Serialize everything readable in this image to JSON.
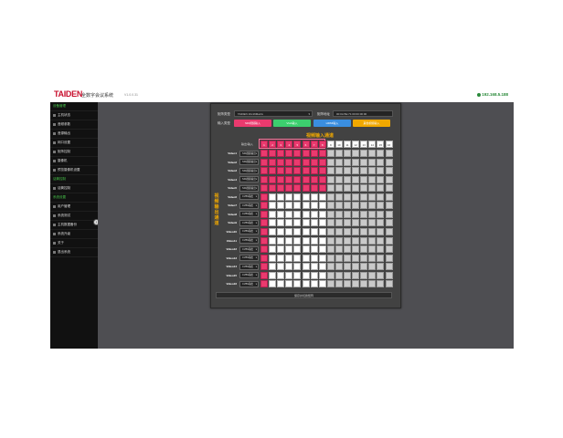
{
  "header": {
    "brand": "TAIDEN",
    "subtitle": "全数字会议系统",
    "version": "V1.0.0.31",
    "ip": "192.168.5.188"
  },
  "sidebar": {
    "sections": [
      {
        "title": "设备管理",
        "items": [
          "主机状态",
          "音频参数",
          "音源输出",
          "网口设置",
          "矩阵控制",
          "摄像机",
          "预览摄像机设置"
        ]
      },
      {
        "title": "话筒控制",
        "items": [
          "话筒控制"
        ]
      },
      {
        "title": "系统设置",
        "items": [
          "用户管理",
          "系统测试",
          "主机数据备份",
          "系统升级",
          "关于",
          "退出系统"
        ]
      }
    ]
  },
  "panel": {
    "matrix_type_label": "矩阵类型",
    "matrix_type_value": "TAIDEN 16x16Matrix",
    "address_label": "矩阵地址",
    "address_value": "00:0A:5E:71:00:00:00:00",
    "input_type_label": "输入类型",
    "modes": [
      {
        "label": "SDI视频输入",
        "color": "#ea3a6e"
      },
      {
        "label": "VGA输入",
        "color": "#3ccf6e"
      },
      {
        "label": "HDMI输入",
        "color": "#3a8ee0"
      },
      {
        "label": "其他视频输入",
        "color": "#f0a800"
      }
    ],
    "grid_title": "视频输入通道",
    "side_label": "视频输出通道",
    "corner_label": "输出\\输入",
    "columns": [
      "1",
      "2",
      "3",
      "4",
      "5",
      "6",
      "7",
      "8",
      "9",
      "10",
      "11",
      "12",
      "13",
      "14",
      "15",
      "16"
    ],
    "rows": [
      {
        "label": "Video1",
        "select": "SDI视频输出"
      },
      {
        "label": "Video2",
        "select": "SDI视频输出"
      },
      {
        "label": "Video3",
        "select": "SDI视频输出"
      },
      {
        "label": "Video4",
        "select": "SDI视频输出"
      },
      {
        "label": "Video5",
        "select": "SDI视频输出"
      },
      {
        "label": "Video6",
        "select": "CVBS输出"
      },
      {
        "label": "Video7",
        "select": "CVBS输出"
      },
      {
        "label": "Video8",
        "select": "CVBS输出"
      },
      {
        "label": "Video9",
        "select": "CVBS输出"
      },
      {
        "label": "Video10",
        "select": "CVBS输出"
      },
      {
        "label": "Video11",
        "select": "CVBS输出"
      },
      {
        "label": "Video12",
        "select": "CVBS输出"
      },
      {
        "label": "Video13",
        "select": "CVBS输出"
      },
      {
        "label": "Video14",
        "select": "CVBS输出"
      },
      {
        "label": "Video15",
        "select": "CVBS输出"
      },
      {
        "label": "Video16",
        "select": "CVBS输出"
      }
    ],
    "selected_columns": 8,
    "selected_rows": 5,
    "apply_label": "保存并切换矩阵"
  }
}
